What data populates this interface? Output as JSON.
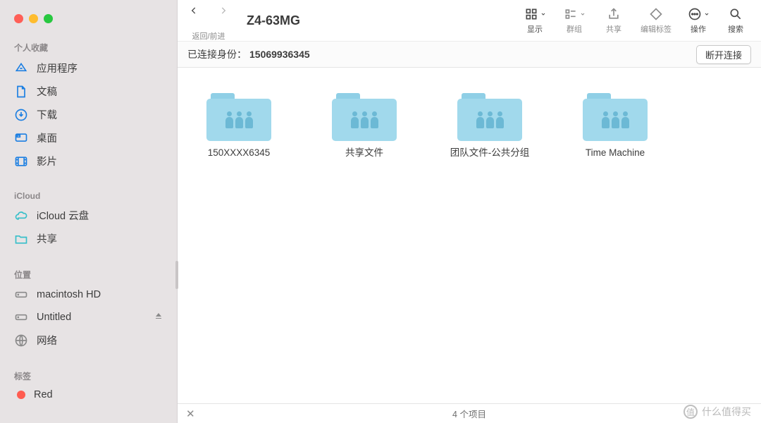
{
  "window": {
    "title": "Z4-63MG"
  },
  "sidebar": {
    "sections": [
      {
        "title": "个人收藏",
        "items": [
          {
            "icon": "apps-icon",
            "label": "应用程序"
          },
          {
            "icon": "doc-icon",
            "label": "文稿"
          },
          {
            "icon": "download-icon",
            "label": "下载"
          },
          {
            "icon": "desktop-icon",
            "label": "桌面"
          },
          {
            "icon": "movie-icon",
            "label": "影片"
          }
        ]
      },
      {
        "title": "iCloud",
        "items": [
          {
            "icon": "cloud-icon",
            "label": "iCloud 云盘"
          },
          {
            "icon": "shared-folder-icon",
            "label": "共享"
          }
        ]
      },
      {
        "title": "位置",
        "items": [
          {
            "icon": "hdd-icon",
            "label": "macintosh HD"
          },
          {
            "icon": "hdd-icon",
            "label": "Untitled",
            "eject": true
          },
          {
            "icon": "globe-icon",
            "label": "网络"
          }
        ]
      },
      {
        "title": "标签",
        "items": [
          {
            "icon": "tag-red",
            "label": "Red"
          }
        ]
      }
    ]
  },
  "toolbar": {
    "back_fwd_label": "返回/前进",
    "view_label": "显示",
    "group_label": "群组",
    "share_label": "共享",
    "tags_label": "编辑标签",
    "action_label": "操作",
    "search_label": "搜索"
  },
  "connection": {
    "prefix": "已连接身份：",
    "identity": "15069936345",
    "disconnect_label": "断开连接"
  },
  "folders": [
    {
      "name": "150XXXX6345"
    },
    {
      "name": "共享文件"
    },
    {
      "name": "团队文件-公共分组"
    },
    {
      "name": "Time Machine"
    }
  ],
  "status": {
    "count_text": "4 个项目"
  },
  "watermark": {
    "text": "什么值得买"
  }
}
